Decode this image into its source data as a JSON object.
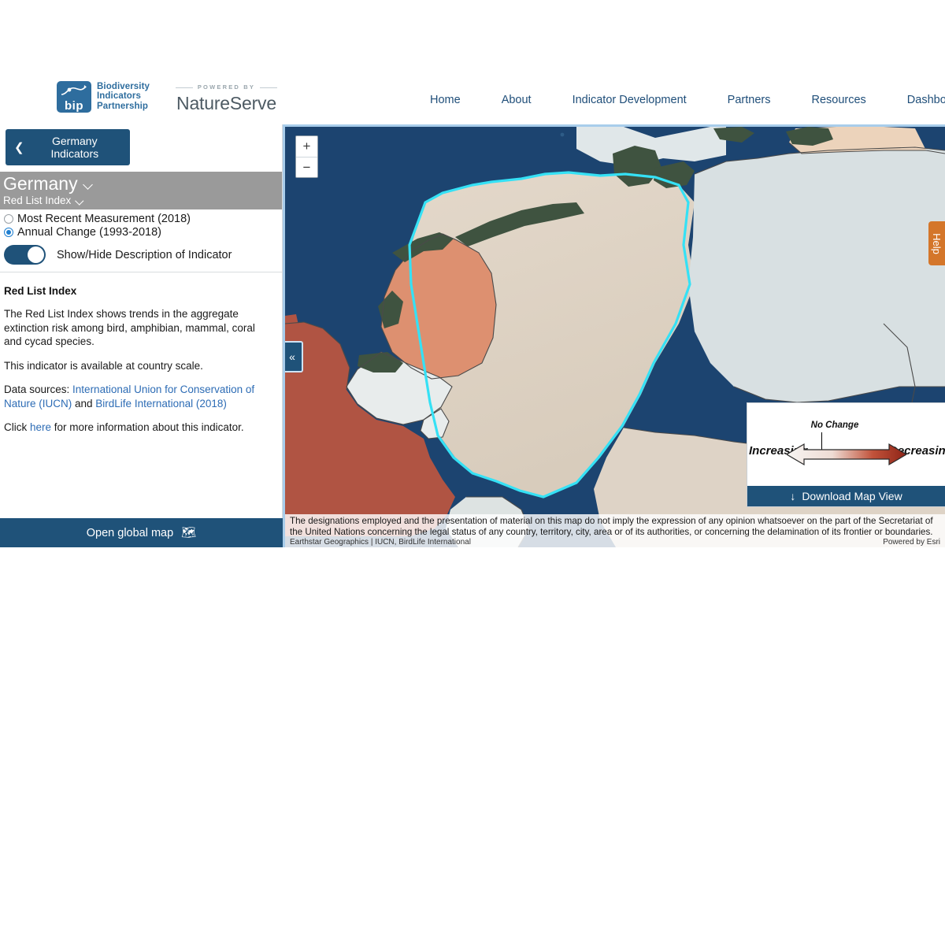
{
  "header": {
    "logo": {
      "bip_mark_text": "bip",
      "bip_lines": [
        "Biodiversity",
        "Indicators",
        "Partnership"
      ]
    },
    "natureserve": {
      "powered_by": "POWERED BY",
      "name": "NatureServe"
    },
    "nav": [
      {
        "label": "Home"
      },
      {
        "label": "About"
      },
      {
        "label": "Indicator Development"
      },
      {
        "label": "Partners"
      },
      {
        "label": "Resources"
      },
      {
        "label": "Dashboard"
      }
    ]
  },
  "sidebar": {
    "back_button": "Germany Indicators",
    "country": "Germany",
    "indicator": "Red List Index",
    "options": [
      {
        "label": "Most Recent Measurement (2018)",
        "selected": false
      },
      {
        "label": "Annual Change (1993-2018)",
        "selected": true
      }
    ],
    "toggle_label": "Show/Hide Description of Indicator",
    "description": {
      "title": "Red List Index",
      "paragraph1": "The Red List Index shows trends in the aggregate extinction risk among bird, amphibian, mammal, coral and cycad species.",
      "paragraph2": "This indicator is available at country scale.",
      "sources_prefix": "Data sources: ",
      "source_link1": "International Union for Conservation of Nature (IUCN)",
      "sources_joiner": " and ",
      "source_link2": "BirdLife International (2018)",
      "click_prefix": "Click ",
      "click_link": "here",
      "click_suffix": " for more information about this indicator."
    },
    "global_map_button": "Open global map"
  },
  "map": {
    "zoom_in": "+",
    "zoom_out": "−",
    "collapse": "«",
    "help": "Help",
    "legend": {
      "no_change": "No Change",
      "increasing": "Increasing",
      "decreasing": "Decreasing",
      "download_button": "Download Map View",
      "download_icon": "↓",
      "gradient_light": "#f2efec",
      "gradient_dark": "#9c2a1c"
    },
    "disclaimer": "The designations employed and the presentation of material on this map do not imply the expression of any opinion whatsoever on the part of the Secretariat of the United Nations concerning the legal status of any country, territory, city, area or of its authorities, or concerning the delamination of its frontier or boundaries.",
    "attribution_left": "Earthstar Geographics | IUCN, BirdLife International",
    "attribution_right": "Powered by Esri",
    "colors": {
      "water": "#1c4470",
      "highlight_outline": "#35e1f5",
      "selected_country": "#ded3c6",
      "neutral_country": "#d8e0e2",
      "increase_country": "#dd9070",
      "decrease_country": "#b05443",
      "tan_country": "#ecd3bb",
      "border": "#3a3a3a"
    }
  }
}
